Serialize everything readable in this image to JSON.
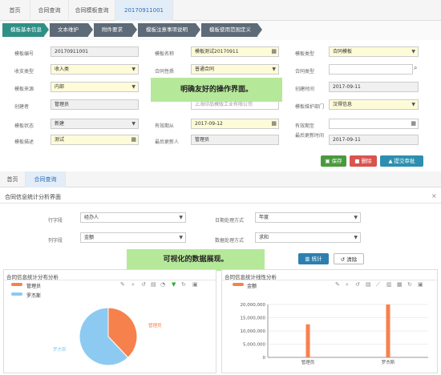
{
  "tabs": [
    "首页",
    "合同查询",
    "合同模板查询",
    "20170911001"
  ],
  "steps": [
    "模板基本信息",
    "文本维护",
    "附件要求",
    "模板注意事项说明",
    "模板使用范围定义"
  ],
  "form": {
    "r1": {
      "l1": "模板编号",
      "v1": "20170911001",
      "l2": "模板名称",
      "v2": "模板测试20170911",
      "l3": "模板类型",
      "v3": "合同模板"
    },
    "r2": {
      "l1": "收支类型",
      "v1": "收入类",
      "l2": "合同性质",
      "v2": "普通合同",
      "l3": "合同类型",
      "v3": ""
    },
    "r3": {
      "l1": "模板来源",
      "v1": "内部",
      "l2": "",
      "v2": "",
      "l3": "创建时间",
      "v3": "2017-09-11"
    },
    "r4": {
      "l1": "创建者",
      "v1": "管理员",
      "l2": "",
      "v2": "上海印品模版工业有限公司",
      "l3": "模板维护部门",
      "v3": "汉得信息"
    },
    "r5": {
      "l1": "模板状态",
      "v1": "新建",
      "l2": "有效期从",
      "v2": "2017-09-12",
      "l3": "有效期至",
      "v3": ""
    },
    "r6": {
      "l1": "模板描述",
      "v1": "测试",
      "l2": "最后更新人",
      "v2": "管理员",
      "l3": "最后更新时间",
      "v3": "2017-09-11"
    }
  },
  "highlight1": "明确友好的操作界面。",
  "actions": {
    "save": "保存",
    "delete": "删除",
    "submit": "提交审批"
  },
  "tabs2": [
    "首页",
    "合同查询"
  ],
  "stat": {
    "title": "合同信息统计分析界面",
    "row_field_label": "行字段",
    "row_field_value": "经办人",
    "col_field_label": "列字段",
    "col_field_value": "金额",
    "date_label": "日期处理方式",
    "date_value": "年度",
    "num_label": "数据处理方式",
    "num_value": "求和",
    "btn_stat": "统计",
    "btn_clear": "清除"
  },
  "highlight2": "可视化的数据展现。",
  "pie_panel": {
    "title": "合同信息统计分布分析",
    "legend": [
      "管理员",
      "罗杰斯"
    ],
    "labels": [
      "管理员",
      "罗杰斯"
    ]
  },
  "bar_panel": {
    "title": "合同信息统计线性分析",
    "legend": "金额",
    "yticks": [
      "20,000,000",
      "15,000,000",
      "10,000,000",
      "5,000,000",
      "0"
    ],
    "xticks": [
      "管理员",
      "罗杰斯"
    ]
  },
  "colors": {
    "orange": "#f7814d",
    "blue": "#8ccaf2",
    "green": "#2f8f85"
  },
  "chart_data": [
    {
      "type": "pie",
      "labels": [
        "管理员",
        "罗杰斯"
      ],
      "values": [
        38,
        62
      ]
    },
    {
      "type": "bar",
      "categories": [
        "管理员",
        "罗杰斯"
      ],
      "series": [
        {
          "name": "金额",
          "values": [
            12500000,
            20000000
          ]
        }
      ],
      "ylim": [
        0,
        20000000
      ]
    }
  ]
}
